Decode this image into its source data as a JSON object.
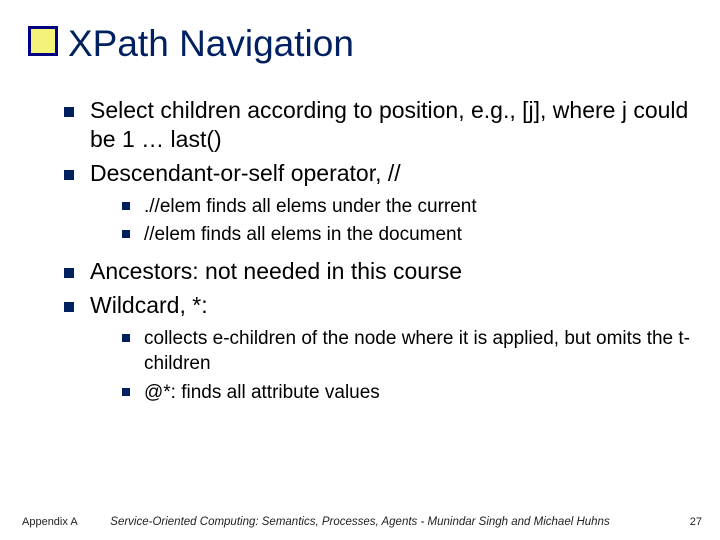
{
  "title": "XPath Navigation",
  "bullets": {
    "b1": "Select children according to position, e.g., [j], where j could be 1 … last()",
    "b2": "Descendant-or-self operator, //",
    "b2_sub": {
      "s1": ".//elem finds all elems under the current",
      "s2": "//elem finds all elems in the document"
    },
    "b3": "Ancestors: not needed in this course",
    "b4": "Wildcard, *:",
    "b4_sub": {
      "s1": "collects e-children of the node where it is applied, but omits the t-children",
      "s2": "@*: finds all attribute values"
    }
  },
  "footer": {
    "left": "Appendix A",
    "center": "Service-Oriented Computing: Semantics, Processes, Agents - Munindar Singh and Michael Huhns",
    "right": "27"
  }
}
